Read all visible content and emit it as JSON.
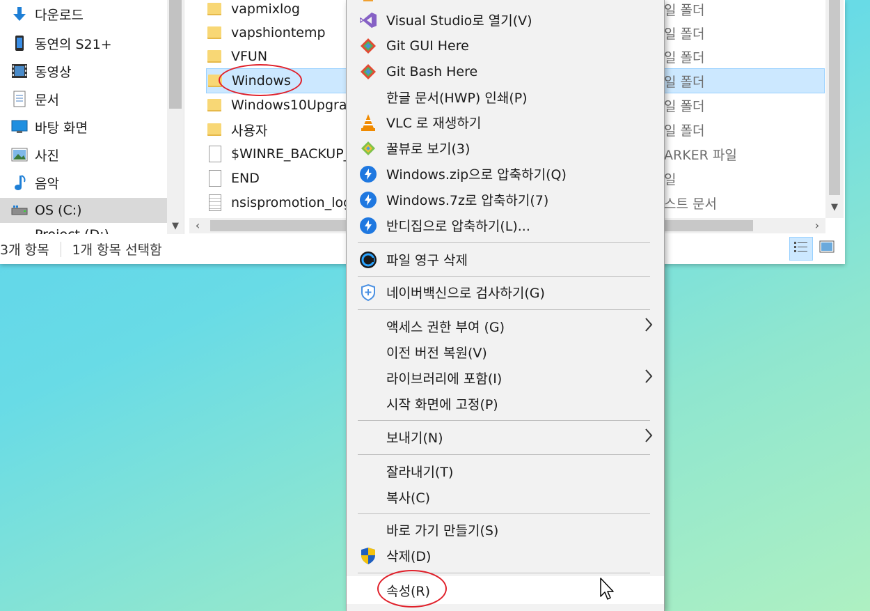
{
  "nav": {
    "items": [
      {
        "label": "다운로드",
        "icon": "download-arrow-icon"
      },
      {
        "label": "동연의 S21+",
        "icon": "phone-icon"
      },
      {
        "label": "동영상",
        "icon": "video-icon"
      },
      {
        "label": "문서",
        "icon": "document-icon"
      },
      {
        "label": "바탕 화면",
        "icon": "desktop-icon"
      },
      {
        "label": "사진",
        "icon": "pictures-icon"
      },
      {
        "label": "음악",
        "icon": "music-icon"
      },
      {
        "label": "OS (C:)",
        "icon": "drive-icon"
      }
    ],
    "cut_item": "Project (D:)"
  },
  "files": [
    {
      "name": "vapmixlog",
      "type": "folder",
      "right": "일 폴더"
    },
    {
      "name": "vapshiontemp",
      "type": "folder",
      "right": "일 폴더"
    },
    {
      "name": "VFUN",
      "type": "folder",
      "right": "일 폴더"
    },
    {
      "name": "Windows",
      "type": "folder",
      "right": "일 폴더"
    },
    {
      "name": "Windows10Upgra",
      "type": "folder",
      "right": "일 폴더"
    },
    {
      "name": "사용자",
      "type": "folder",
      "right": "일 폴더"
    },
    {
      "name": "$WINRE_BACKUP_",
      "type": "file",
      "right": "ARKER 파일"
    },
    {
      "name": "END",
      "type": "file",
      "right": "일"
    },
    {
      "name": "nsispromotion_log",
      "type": "text",
      "right": "스트 문서"
    }
  ],
  "status": {
    "count": "3개 항목",
    "selected": "1개 항목 선택함"
  },
  "menu": {
    "items": [
      {
        "label": "Visual Studio로 열기(V)",
        "icon": "visual-studio-icon"
      },
      {
        "label": "Git GUI Here",
        "icon": "git-gui-icon"
      },
      {
        "label": "Git Bash Here",
        "icon": "git-bash-icon"
      },
      {
        "label": "한글 문서(HWP) 인쇄(P)",
        "icon": ""
      },
      {
        "label": "VLC 로 재생하기",
        "icon": "vlc-cone-icon"
      },
      {
        "label": "꿀뷰로 보기(3)",
        "icon": "honeyview-icon"
      },
      {
        "label": "Windows.zip으로 압축하기(Q)",
        "icon": "bandizip-icon"
      },
      {
        "label": "Windows.7z로 압축하기(7)",
        "icon": "bandizip-icon"
      },
      {
        "label": "반디집으로 압축하기(L)...",
        "icon": "bandizip-icon"
      },
      {
        "label": "파일 영구 삭제",
        "icon": "ccleaner-icon"
      },
      {
        "label": "네이버백신으로 검사하기(G)",
        "icon": "naver-vaccine-shield-icon"
      },
      {
        "label": "액세스 권한 부여 (G)",
        "icon": ""
      },
      {
        "label": "이전 버전 복원(V)",
        "icon": ""
      },
      {
        "label": "라이브러리에 포함(I)",
        "icon": ""
      },
      {
        "label": "시작 화면에 고정(P)",
        "icon": ""
      },
      {
        "label": "보내기(N)",
        "icon": ""
      },
      {
        "label": "잘라내기(T)",
        "icon": ""
      },
      {
        "label": "복사(C)",
        "icon": ""
      },
      {
        "label": "바로 가기 만들기(S)",
        "icon": ""
      },
      {
        "label": "삭제(D)",
        "icon": "uac-shield-icon"
      },
      {
        "label": "속성(R)",
        "icon": ""
      }
    ]
  },
  "colors": {
    "highlight_oval": "#e0202a",
    "selection": "#cce8ff"
  }
}
